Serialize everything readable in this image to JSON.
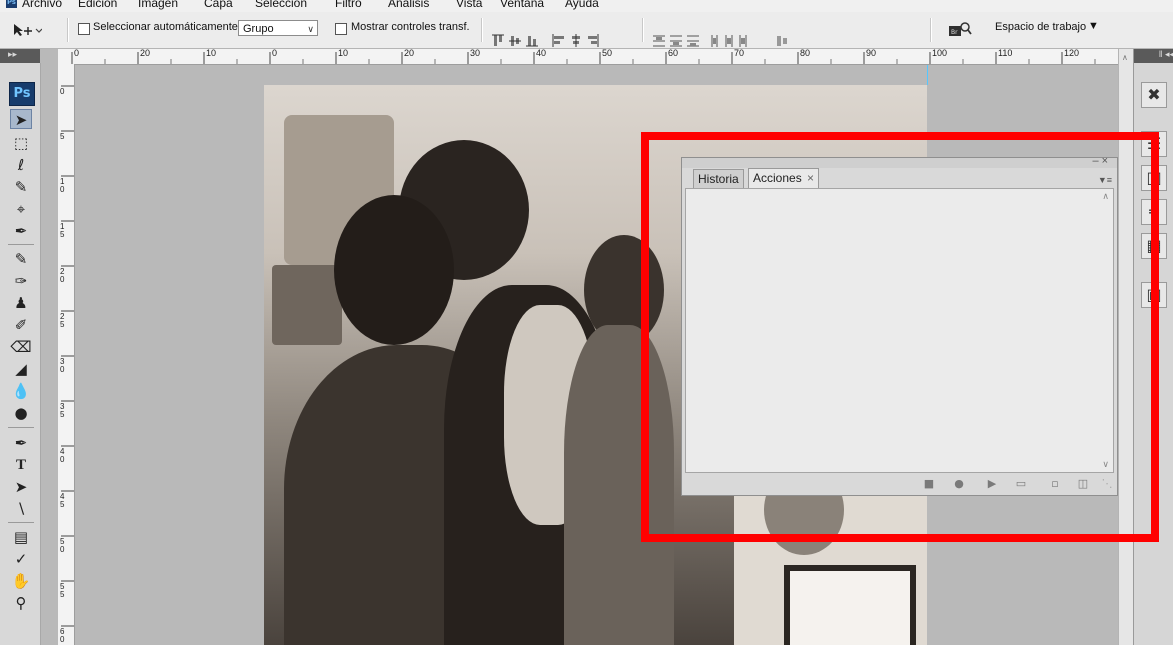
{
  "menubar": {
    "items": [
      "Archivo",
      "Edición",
      "Imagen",
      "Capa",
      "Selección",
      "Filtro",
      "Análisis",
      "Vista",
      "Ventana",
      "Ayuda"
    ]
  },
  "options_bar": {
    "auto_select_label": "Seleccionar automáticamente:",
    "auto_select_value": "Grupo",
    "show_transform_label": "Mostrar controles transf.",
    "workspace_label": "Espacio de trabajo"
  },
  "tools": {
    "logo": "Ps",
    "items": [
      "move-tool",
      "marquee-tool",
      "lasso-tool",
      "quick-selection-tool",
      "crop-tool",
      "slice-tool",
      "healing-brush-tool",
      "brush-tool",
      "clone-stamp-tool",
      "history-brush-tool",
      "eraser-tool",
      "paint-bucket-tool",
      "blur-tool",
      "dodge-tool",
      "pen-tool",
      "type-tool",
      "path-selection-tool",
      "line-tool",
      "notes-tool",
      "eyedropper-tool",
      "hand-tool",
      "zoom-tool"
    ]
  },
  "ruler_top": {
    "labels": [
      "0",
      "20",
      "10",
      "0",
      "10",
      "20",
      "30",
      "40",
      "50",
      "60",
      "70",
      "80",
      "90",
      "100",
      "110",
      "120"
    ]
  },
  "ruler_left": {
    "labels": [
      "0",
      "5",
      "10",
      "15",
      "20",
      "25",
      "30",
      "35",
      "40",
      "45",
      "50",
      "55",
      "60"
    ]
  },
  "panel": {
    "tabs": [
      {
        "label": "Historia",
        "active": false
      },
      {
        "label": "Acciones",
        "active": true
      }
    ],
    "close_tab_glyph": "×"
  },
  "colors": {
    "highlight": "#ff0000",
    "panel_bg": "#ebebeb",
    "ps_blue": "#173c6c"
  }
}
